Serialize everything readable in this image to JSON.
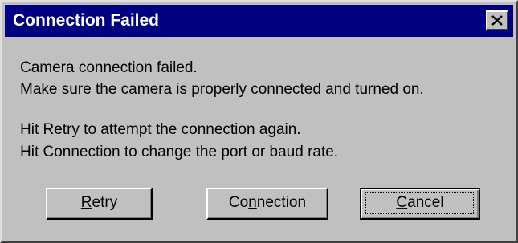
{
  "window": {
    "title": "Connection Failed",
    "close_icon": "close-x-icon"
  },
  "message": {
    "line1": "Camera connection failed.",
    "line2": "Make sure the camera is properly connected and turned on.",
    "line3": "Hit Retry to attempt the connection again.",
    "line4": "Hit Connection to change the port or baud rate."
  },
  "buttons": {
    "retry": {
      "mnemonic": "R",
      "rest": "etry"
    },
    "connection": {
      "pre": "Co",
      "mnemonic": "n",
      "rest": "nection"
    },
    "cancel": {
      "mnemonic": "C",
      "rest": "ancel"
    }
  },
  "colors": {
    "titlebar": "#000080",
    "face": "#c0c0c0"
  }
}
